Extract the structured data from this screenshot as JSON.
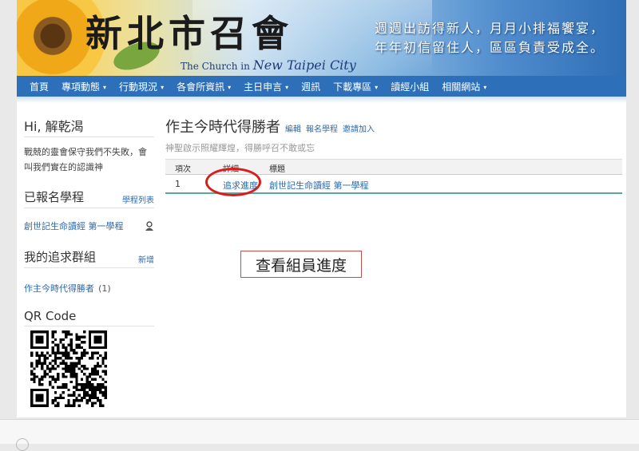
{
  "header": {
    "logo_title": "新北市召會",
    "logo_sub_small": "The Church in",
    "logo_sub_big": "New Taipei City",
    "slogan_line1": "週週出訪得新人，月月小排福饗宴，",
    "slogan_line2": "年年初信留住人，區區負責受成全。"
  },
  "nav": {
    "items": [
      {
        "label": "首頁",
        "dropdown": false
      },
      {
        "label": "專項動態",
        "dropdown": true
      },
      {
        "label": "行動現況",
        "dropdown": true
      },
      {
        "label": "各會所資訊",
        "dropdown": true
      },
      {
        "label": "主日申言",
        "dropdown": true
      },
      {
        "label": "週訊",
        "dropdown": false
      },
      {
        "label": "下載專區",
        "dropdown": true
      },
      {
        "label": "讀經小組",
        "dropdown": false
      },
      {
        "label": "相關網站",
        "dropdown": true
      }
    ],
    "caret": "▾"
  },
  "sidebar": {
    "greeting": "Hi, 解乾渴",
    "verse": "戰兢的靈會保守我們不失敗，會叫我們實在的認識神",
    "enrolled_title": "已報名學程",
    "enrolled_link": "學程列表",
    "enrolled_item": "創世記生命讀經 第一學程",
    "groups_title": "我的追求群組",
    "groups_link": "新增",
    "group_name": "作主今時代得勝者",
    "group_count": "(1)",
    "qr_title": "QR Code"
  },
  "main": {
    "title": "作主今時代得勝者",
    "link_edit": "編輯",
    "link_enroll": "報名學程",
    "link_invite": "邀請加入",
    "subtitle": "神聖啟示照耀輝煌，得勝呼召不敢或忘",
    "table": {
      "headers": {
        "no": "項次",
        "detail": "詳細",
        "title": "標題"
      },
      "rows": [
        {
          "no": "1",
          "detail": "追求進度",
          "title": "創世記生命讀經 第一學程"
        }
      ]
    },
    "annotation": "查看組員進度"
  },
  "colors": {
    "nav_bg": "#2d6fb8",
    "link": "#2a6ab0",
    "circle": "#d81d1d"
  }
}
